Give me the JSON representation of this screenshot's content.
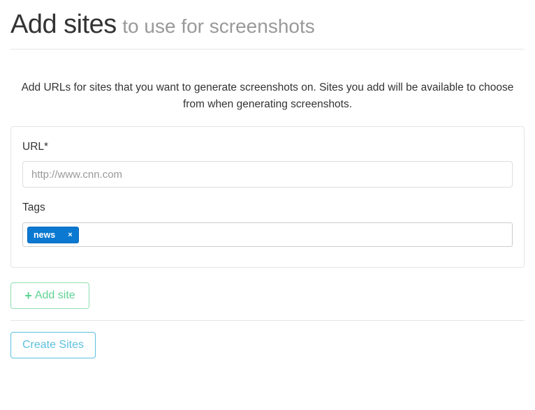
{
  "header": {
    "title": "Add sites",
    "subtitle": "to use for screenshots"
  },
  "intro": {
    "text": "Add URLs for sites that you want to generate screenshots on. Sites you add will be available to choose from when generating screenshots."
  },
  "form": {
    "url_label": "URL*",
    "url_value": "",
    "url_placeholder": "http://www.cnn.com",
    "tags_label": "Tags",
    "tags": [
      {
        "label": "news",
        "remove": "×"
      }
    ]
  },
  "buttons": {
    "add_site_icon": "plus-icon",
    "add_site_label": "Add site",
    "create_sites_label": "Create Sites"
  },
  "colors": {
    "tag_bg": "#0b78d1",
    "success": "#5fd394",
    "info": "#5bc0de"
  }
}
